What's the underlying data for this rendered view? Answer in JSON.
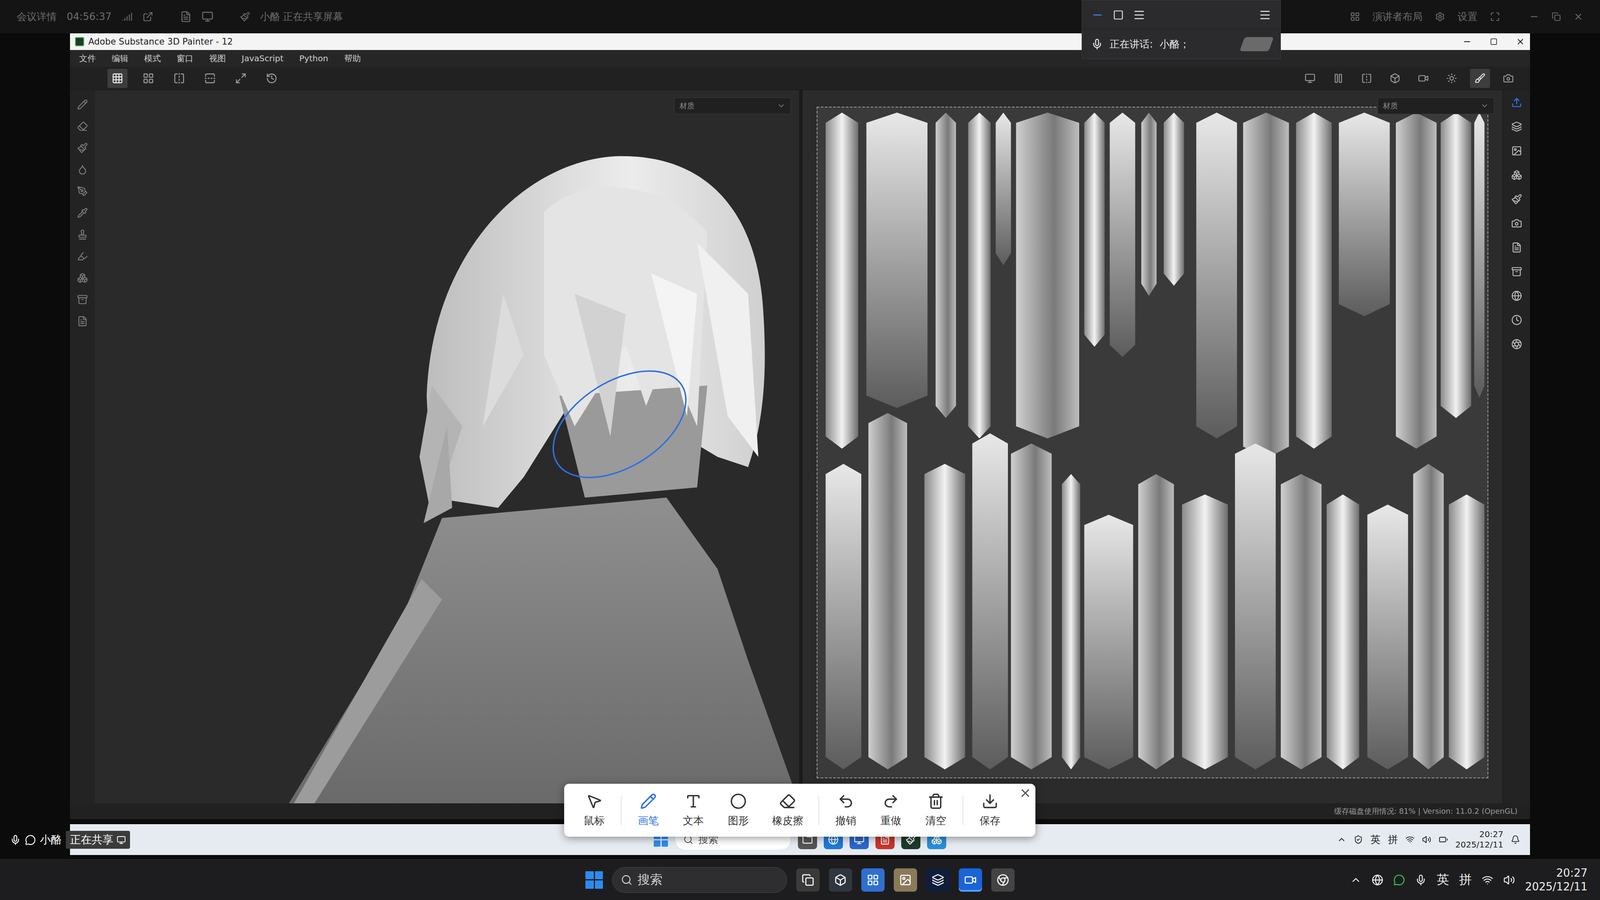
{
  "meeting": {
    "title": "会议详情",
    "timer": "04:56:37",
    "sharing": "小酪 正在共享屏幕",
    "layout": "演讲者布局",
    "settings": "设置"
  },
  "speaking": {
    "label": "正在讲话:",
    "name": "小酪；"
  },
  "window": {
    "title": "Adobe Substance 3D Painter - 12"
  },
  "menu": [
    "文件",
    "编辑",
    "模式",
    "窗口",
    "视图",
    "JavaScript",
    "Python",
    "帮助"
  ],
  "toolbar_left": [
    {
      "selected": true
    },
    {
      "selected": false
    },
    {
      "selected": false
    },
    {
      "selected": false
    },
    {
      "selected": false
    },
    {
      "selected": false
    }
  ],
  "toolbar_right": [
    {
      "selected": false
    },
    {
      "selected": false
    },
    {
      "selected": false
    },
    {
      "selected": false
    },
    {
      "selected": false
    },
    {
      "selected": false
    },
    {
      "selected": true
    },
    {
      "selected": false
    }
  ],
  "right_panel": [
    {
      "selected": true
    },
    {
      "selected": false
    },
    {
      "selected": false
    },
    {
      "selected": false
    },
    {
      "selected": false
    },
    {
      "selected": false
    },
    {
      "selected": false
    },
    {
      "selected": false
    },
    {
      "selected": false
    },
    {
      "selected": false
    },
    {
      "selected": false
    }
  ],
  "viewports": [
    {
      "name": "3d",
      "dropdown": "材质"
    },
    {
      "name": "2d",
      "dropdown": "材质"
    }
  ],
  "status_bar": {
    "text": "缓存磁盘使用情况:  81% | Version: 11.0.2 (OpenGL)"
  },
  "annotation_toolbar": {
    "tools": [
      {
        "label": "鼠标",
        "selected": false
      },
      {
        "label": "画笔",
        "selected": true
      },
      {
        "label": "文本",
        "selected": false
      },
      {
        "label": "图形",
        "selected": false
      },
      {
        "label": "橡皮擦",
        "selected": false
      },
      {
        "label": "撤销",
        "selected": false
      },
      {
        "label": "重做",
        "selected": false
      },
      {
        "label": "清空",
        "selected": false
      },
      {
        "label": "保存",
        "selected": false
      }
    ],
    "close": "×"
  },
  "sharing_badge": {
    "name": "小酪",
    "status": "正在共享"
  },
  "inner_taskbar": {
    "search": "搜索",
    "ime": [
      "英",
      "拼"
    ],
    "time": "20:27",
    "date": "2025/12/11"
  },
  "taskbar": {
    "search": "搜索",
    "ime": [
      "英",
      "拼"
    ],
    "time": "20:27",
    "date": "2025/12/11"
  }
}
